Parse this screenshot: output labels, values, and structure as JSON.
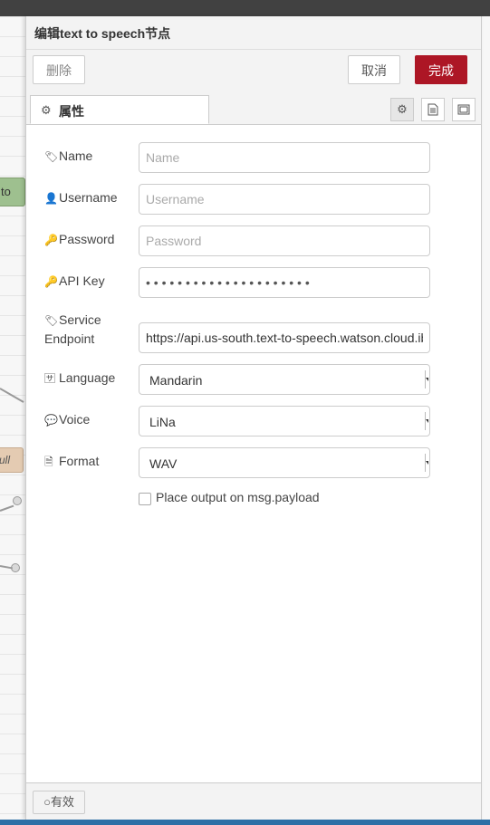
{
  "dialog": {
    "title": "编辑text to speech节点",
    "delete_label": "删除",
    "cancel_label": "取消",
    "done_label": "完成",
    "tab_label": "属性",
    "valid_label": "有效",
    "accent_color": "#ad1625"
  },
  "canvas": {
    "node1_label": "to",
    "node2_label": "ull"
  },
  "form": {
    "name": {
      "label": "Name",
      "placeholder": "Name",
      "value": ""
    },
    "username": {
      "label": "Username",
      "placeholder": "Username",
      "value": ""
    },
    "password": {
      "label": "Password",
      "placeholder": "Password",
      "value": ""
    },
    "apikey": {
      "label": "API Key",
      "value": "• • • • • • • • • • • • • • • • • • • • •"
    },
    "endpoint": {
      "label_line1": "Service",
      "label_line2": "Endpoint",
      "value": "https://api.us-south.text-to-speech.watson.cloud.ibm.com"
    },
    "language": {
      "label": "Language",
      "value": "Mandarin"
    },
    "voice": {
      "label": "Voice",
      "value": "LiNa"
    },
    "format": {
      "label": "Format",
      "value": "WAV"
    },
    "payload_checkbox": {
      "label": "Place output on msg.payload",
      "checked": false
    }
  },
  "icons": [
    "tag-icon",
    "user-icon",
    "key-icon",
    "language-icon",
    "comment-icon",
    "file-audio-icon",
    "gear-icon",
    "file-icon",
    "frame-icon",
    "circle-icon"
  ]
}
